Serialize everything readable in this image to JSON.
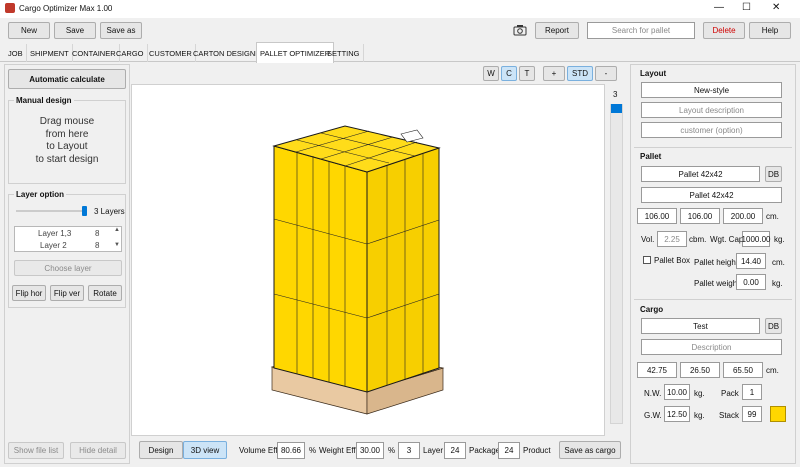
{
  "window": {
    "title": "Cargo Optimizer Max 1.00",
    "minimize": "—",
    "maximize": "☐",
    "close": "✕"
  },
  "toolbar": {
    "new": "New",
    "save": "Save",
    "save_as": "Save as",
    "report": "Report",
    "search_placeholder": "Search for pallet",
    "delete": "Delete",
    "help": "Help"
  },
  "tabs": [
    "JOB",
    "SHIPMENT",
    "CONTAINER",
    "CARGO",
    "CUSTOMER",
    "CARTON DESIGNER",
    "PALLET OPTIMIZER",
    "SETTING"
  ],
  "left": {
    "auto_calc": "Automatic calculate",
    "manual_title": "Manual design",
    "manual_hint": [
      "Drag mouse",
      "from here",
      "to Layout",
      "to start design"
    ],
    "layer_title": "Layer option",
    "layers_label": "3 Layers",
    "layer_rows": [
      {
        "name": "Layer 1,3",
        "count": "8"
      },
      {
        "name": "Layer 2",
        "count": "8"
      }
    ],
    "choose_layer": "Choose layer",
    "flip_hor": "Flip hor",
    "flip_ver": "Flip ver",
    "rotate": "Rotate",
    "show_file_list": "Show file list",
    "hide_detail": "Hide detail"
  },
  "view": {
    "w": "W",
    "c": "C",
    "t": "T",
    "plus": "+",
    "std": "STD",
    "minus": "-",
    "layer_num": "3"
  },
  "bottom": {
    "design": "Design",
    "view3d": "3D view",
    "vol_label": "Volume Eff.",
    "vol_value": "80.66",
    "pct1": "%",
    "wt_label": "Weight Eff.",
    "wt_value": "30.00",
    "pct2": "%",
    "layer_value": "3",
    "layer_label": "Layer",
    "package_value": "24",
    "package_label": "Package",
    "product_value": "24",
    "product_label": "Product",
    "save_as_cargo": "Save as cargo"
  },
  "layout": {
    "title": "Layout",
    "style": "New-style",
    "desc_placeholder": "Layout description",
    "customer_placeholder": "customer (option)"
  },
  "pallet": {
    "title": "Pallet",
    "name": "Pallet 42x42",
    "db": "DB",
    "name2": "Pallet 42x42",
    "dims": [
      "106.00",
      "106.00",
      "200.00"
    ],
    "cm": "cm.",
    "vol_label": "Vol.",
    "vol": "2.25",
    "cbm": "cbm.",
    "wgt_cap_label": "Wgt. Cap.",
    "wgt_cap": "1000.00",
    "kg": "kg.",
    "pallet_box": "Pallet Box",
    "height_label": "Pallet height",
    "height": "14.40",
    "cm2": "cm.",
    "weight_label": "Pallet weight",
    "weight": "0.00",
    "kg2": "kg."
  },
  "cargo": {
    "title": "Cargo",
    "name": "Test",
    "db": "DB",
    "desc_placeholder": "Description",
    "dims": [
      "42.75",
      "26.50",
      "65.50"
    ],
    "cm": "cm.",
    "nw_label": "N.W.",
    "nw": "10.00",
    "kg1": "kg.",
    "pack_label": "Pack",
    "pack": "1",
    "gw_label": "G.W.",
    "gw": "12.50",
    "kg2": "kg.",
    "stack_label": "Stack",
    "stack": "99",
    "color": "#ffd700"
  },
  "colors": {
    "box": "#ffd700",
    "pallet": "#e8c8a0",
    "accent": "#0078d7"
  }
}
